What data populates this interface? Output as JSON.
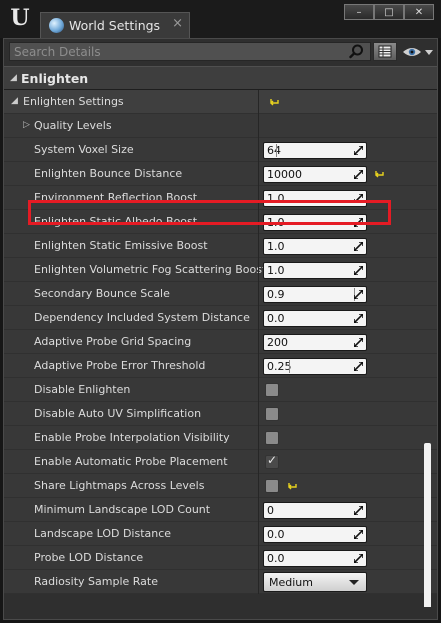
{
  "window": {
    "tab_title": "World Settings",
    "tab_close": "×",
    "buttons": [
      "–",
      "□",
      "✕"
    ]
  },
  "search": {
    "placeholder": "Search Details"
  },
  "section": {
    "title": "Enlighten"
  },
  "category": {
    "label": "Enlighten Settings"
  },
  "subcategory": {
    "label": "Quality Levels"
  },
  "properties": [
    {
      "label": "System Voxel Size",
      "type": "number",
      "value": "64",
      "slider_fraction": 0.12
    },
    {
      "label": "Enlighten Bounce Distance",
      "type": "number",
      "value": "10000",
      "reset": true
    },
    {
      "label": "Environment Reflection Boost",
      "type": "number",
      "value": "1.0"
    },
    {
      "label": "Enlighten Static Albedo Boost",
      "type": "number",
      "value": "1.0"
    },
    {
      "label": "Enlighten Static Emissive Boost",
      "type": "number",
      "value": "1.0"
    },
    {
      "label": "Enlighten Volumetric Fog Scattering Boost",
      "type": "number",
      "value": "1.0"
    },
    {
      "label": "Secondary Bounce Scale",
      "type": "number",
      "value": "0.9",
      "slider_fraction": 0.9
    },
    {
      "label": "Dependency Included System Distance",
      "type": "number",
      "value": "0.0"
    },
    {
      "label": "Adaptive Probe Grid Spacing",
      "type": "number",
      "value": "200"
    },
    {
      "label": "Adaptive Probe Error Threshold",
      "type": "number",
      "value": "0.25",
      "slider_fraction": 0.25
    },
    {
      "label": "Disable Enlighten",
      "type": "checkbox",
      "checked": false
    },
    {
      "label": "Disable Auto UV Simplification",
      "type": "checkbox",
      "checked": false
    },
    {
      "label": "Enable Probe Interpolation Visibility",
      "type": "checkbox",
      "checked": false
    },
    {
      "label": "Enable Automatic Probe Placement",
      "type": "checkbox",
      "checked": true
    },
    {
      "label": "Share Lightmaps Across Levels",
      "type": "checkbox",
      "checked": false,
      "reset": true
    },
    {
      "label": "Minimum Landscape LOD Count",
      "type": "number",
      "value": "0"
    },
    {
      "label": "Landscape LOD Distance",
      "type": "number",
      "value": "0.0"
    },
    {
      "label": "Probe LOD Distance",
      "type": "number",
      "value": "0.0"
    },
    {
      "label": "Radiosity Sample Rate",
      "type": "combo",
      "value": "Medium"
    }
  ],
  "colors": {
    "highlight": "#e51b24",
    "reset_arrow": "#e8d21e"
  }
}
